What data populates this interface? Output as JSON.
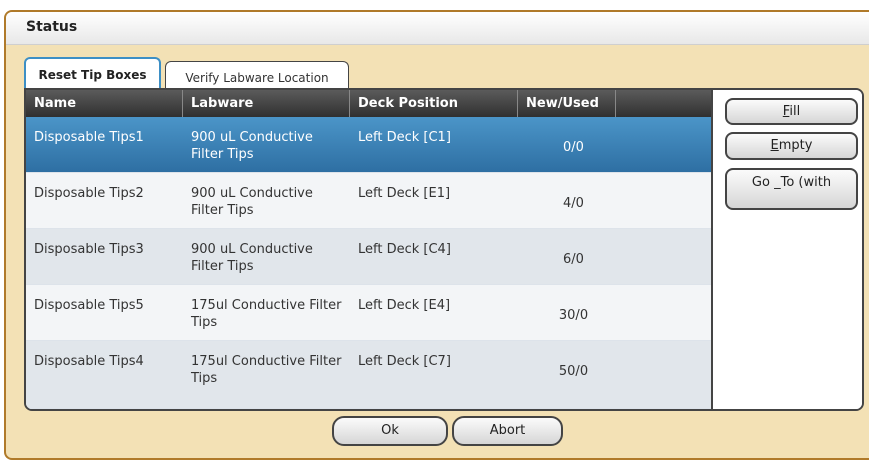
{
  "window": {
    "title": "Status"
  },
  "tabs": [
    {
      "label": "Reset Tip Boxes",
      "active": true
    },
    {
      "label": "Verify Labware Location",
      "active": false
    }
  ],
  "grid": {
    "columns": [
      "Name",
      "Labware",
      "Deck Position",
      "New/Used",
      ""
    ],
    "rows": [
      {
        "name": "Disposable Tips1",
        "labware_line1": "900 uL Conductive",
        "labware_line2": "Filter Tips",
        "deck": "Left Deck [C1]",
        "new_used": "0/0",
        "selected": true
      },
      {
        "name": "Disposable Tips2",
        "labware_line1": "900 uL Conductive",
        "labware_line2": "Filter Tips",
        "deck": "Left Deck [E1]",
        "new_used": "4/0",
        "selected": false
      },
      {
        "name": "Disposable Tips3",
        "labware_line1": "900 uL Conductive",
        "labware_line2": "Filter Tips",
        "deck": "Left Deck [C4]",
        "new_used": "6/0",
        "selected": false
      },
      {
        "name": "Disposable Tips5",
        "labware_line1": "175ul Conductive Filter",
        "labware_line2": "Tips",
        "deck": "Left Deck [E4]",
        "new_used": "30/0",
        "selected": false
      },
      {
        "name": "Disposable Tips4",
        "labware_line1": "175ul Conductive Filter",
        "labware_line2": "Tips",
        "deck": "Left Deck [C7]",
        "new_used": "50/0",
        "selected": false
      }
    ]
  },
  "side_buttons": {
    "fill": {
      "mnemonic": "F",
      "rest": "ill"
    },
    "empty": {
      "mnemonic": "E",
      "rest": "mpty"
    },
    "goto": "Go _To (with"
  },
  "footer": {
    "ok_label": "Ok",
    "abort_label": "Abort"
  },
  "colors": {
    "selected_row": "#2e6fa3",
    "window_frame": "#b07a2a",
    "window_bg": "#f3e1b5"
  }
}
